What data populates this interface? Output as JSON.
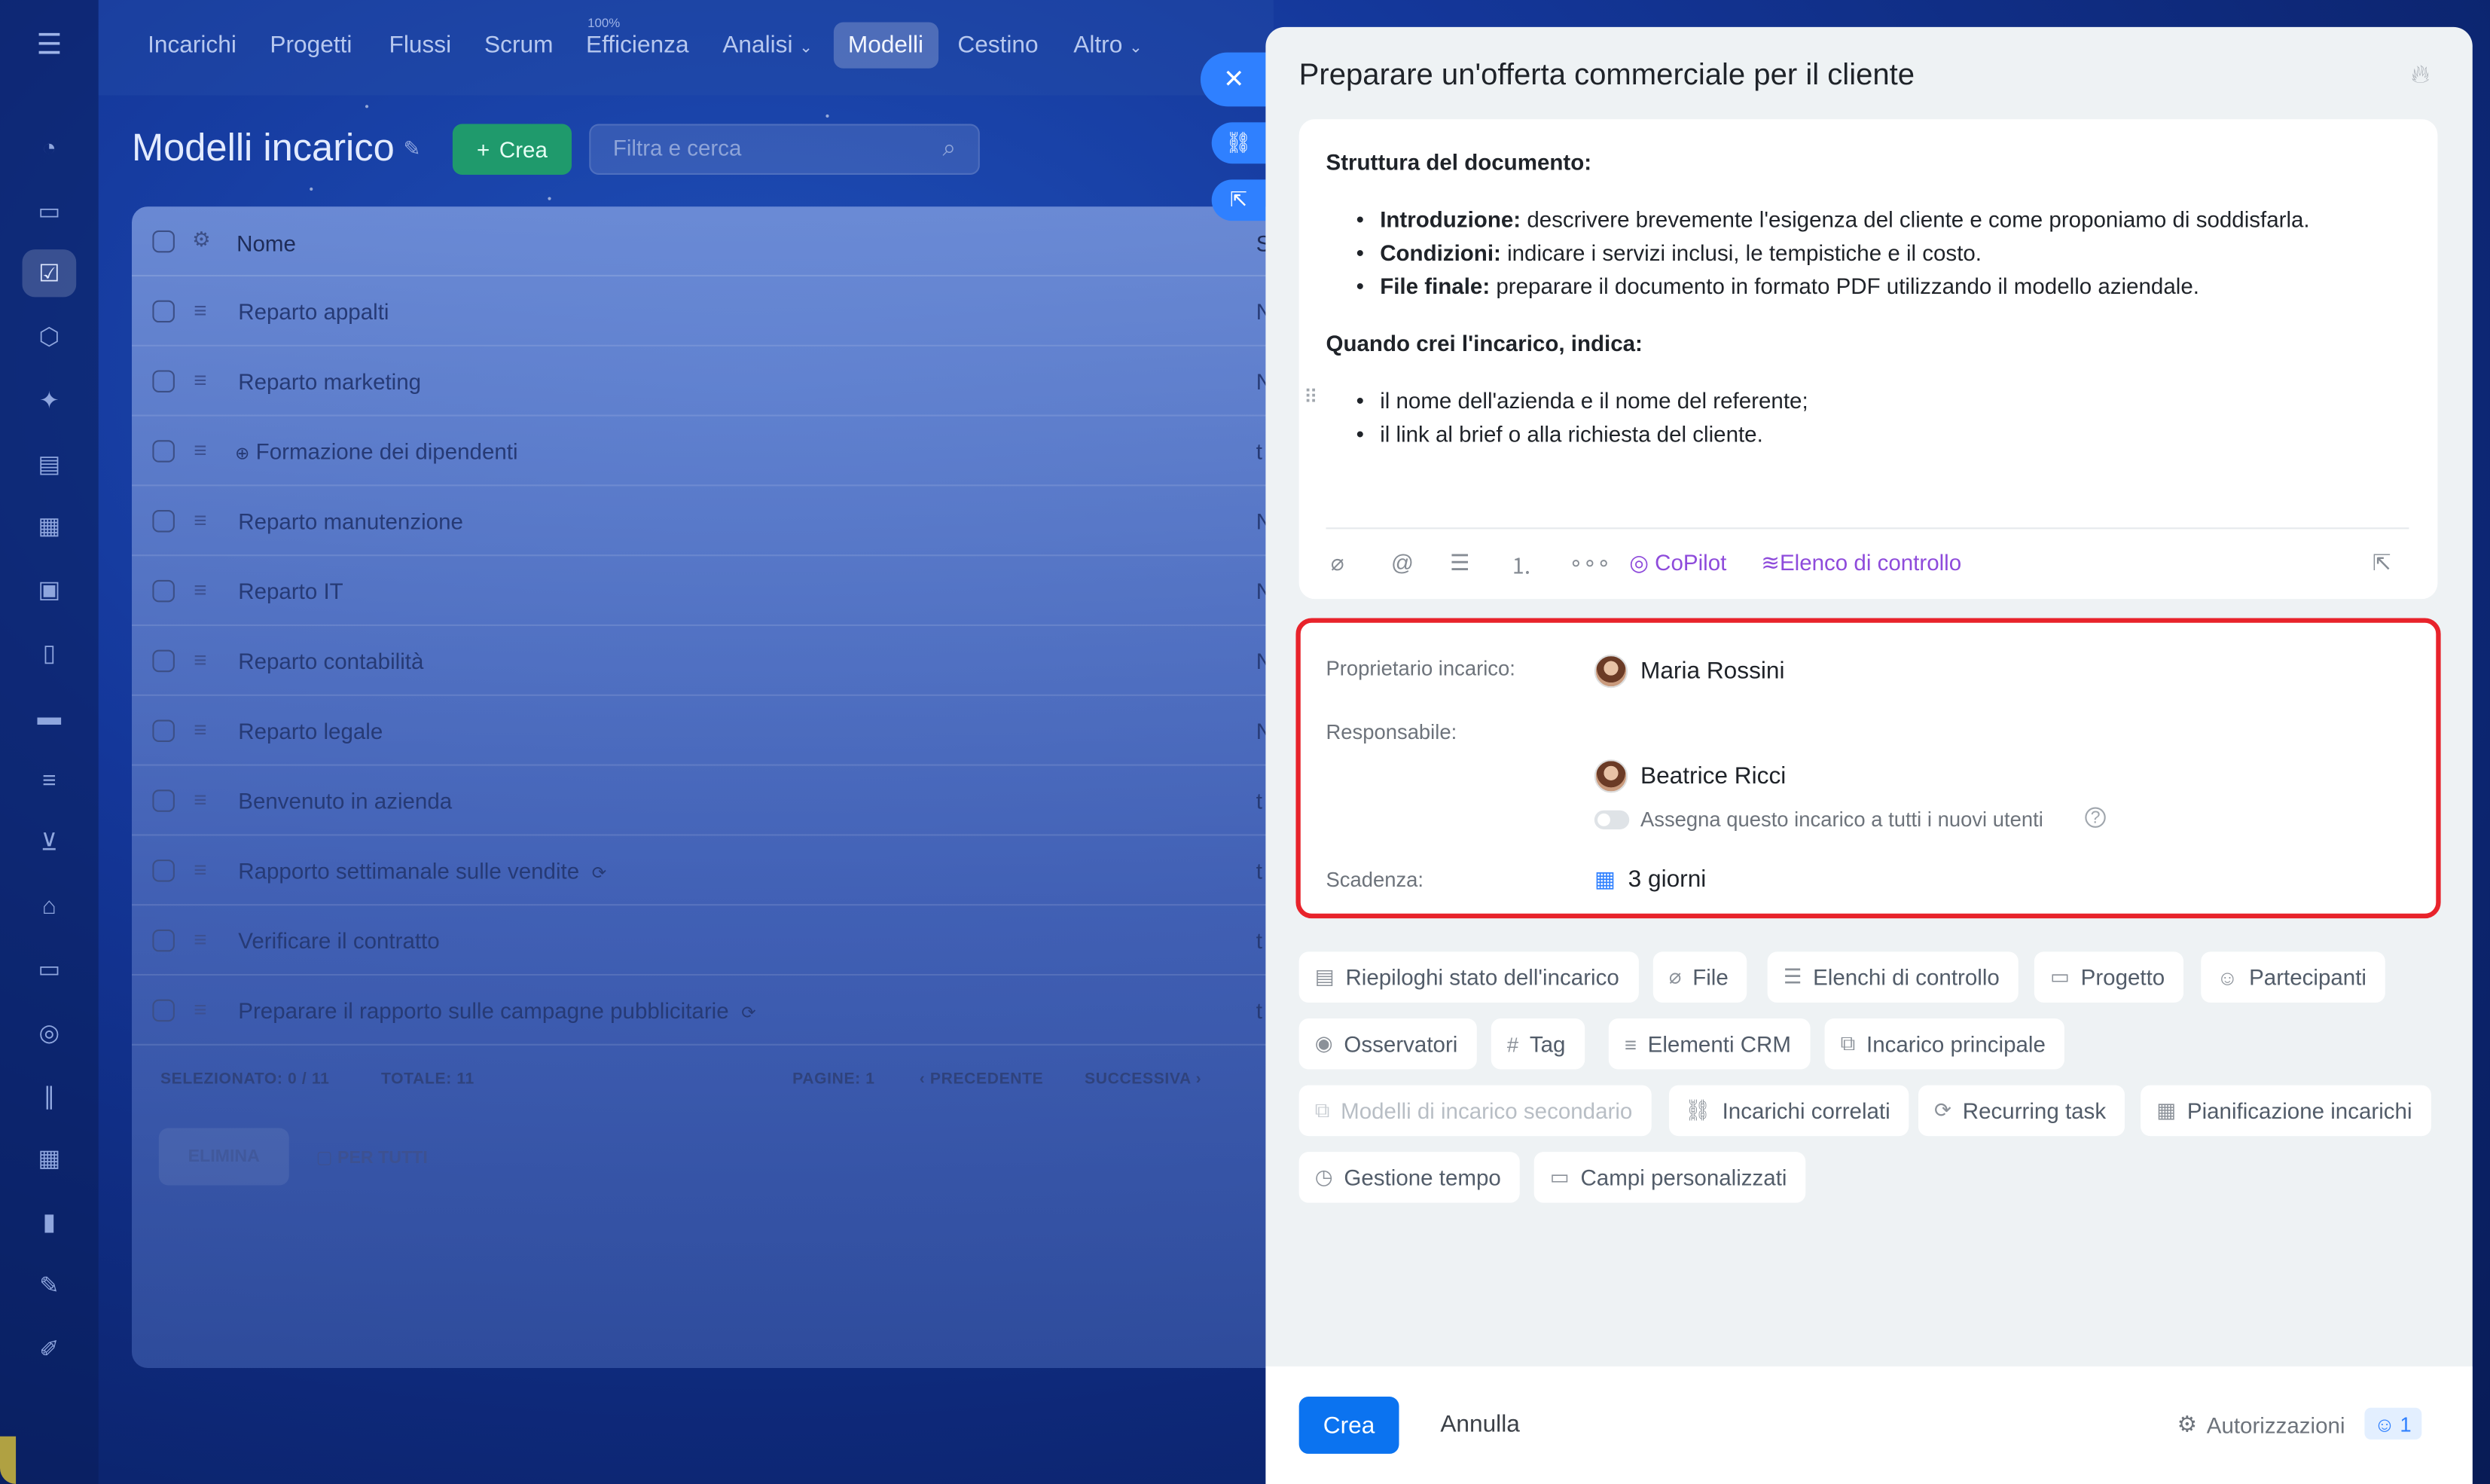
{
  "nav": {
    "items": [
      "Incarichi",
      "Progetti",
      "Flussi",
      "Scrum",
      "Efficienza",
      "Analisi",
      "Modelli",
      "Cestino",
      "Altro"
    ],
    "efficiency_badge": "100%",
    "active": "Modelli"
  },
  "page": {
    "title": "Modelli incarico",
    "create_label": "Crea",
    "search_placeholder": "Filtra e cerca"
  },
  "list": {
    "column_name": "Nome",
    "column_s": "S",
    "rows": [
      {
        "name": "Reparto appalti",
        "tail": "N"
      },
      {
        "name": "Reparto marketing",
        "tail": "N"
      },
      {
        "name": "Formazione dei dipendenti",
        "tail": "t"
      },
      {
        "name": "Reparto manutenzione",
        "tail": "N"
      },
      {
        "name": "Reparto IT",
        "tail": "N"
      },
      {
        "name": "Reparto contabilità",
        "tail": "N"
      },
      {
        "name": "Reparto legale",
        "tail": "N"
      },
      {
        "name": "Benvenuto in azienda",
        "tail": "t"
      },
      {
        "name": "Rapporto settimanale sulle vendite",
        "tail": "t"
      },
      {
        "name": "Verificare il contratto",
        "tail": "t"
      },
      {
        "name": "Preparare il rapporto sulle campagne pubblicitarie",
        "tail": "t"
      }
    ],
    "footer": {
      "selected": "SELEZIONATO: 0 / 11",
      "total": "TOTALE: 11",
      "pages": "PAGINE: 1",
      "prev": "‹ PRECEDENTE",
      "next": "SUCCESSIVA ›"
    },
    "delete_label": "ELIMINA",
    "for_all_label": "PER TUTTI"
  },
  "task": {
    "title": "Preparare un'offerta commerciale per il cliente",
    "section1_heading": "Struttura del documento:",
    "section1_items": [
      {
        "bold": "Introduzione:",
        "text": " descrivere brevemente l'esigenza del cliente e come proponiamo di soddisfarla."
      },
      {
        "bold": "Condizioni:",
        "text": " indicare i servizi inclusi, le tempistiche e il costo."
      },
      {
        "bold": "File finale:",
        "text": " preparare il documento in formato PDF utilizzando il modello aziendale."
      }
    ],
    "section2_heading": "Quando crei l'incarico, indica:",
    "section2_items": [
      "il nome dell'azienda e il nome del referente;",
      "il link al brief o alla richiesta del cliente."
    ],
    "toolbar": {
      "copilot": "CoPilot",
      "checklist": "Elenco di controllo"
    }
  },
  "fields": {
    "owner_label": "Proprietario incarico:",
    "owner_name": "Maria Rossini",
    "responsible_label": "Responsabile:",
    "responsible_name": "Beatrice Ricci",
    "assign_all_label": "Assegna questo incarico a tutti i nuovi utenti",
    "deadline_label": "Scadenza:",
    "deadline_value": "3 giorni"
  },
  "chips": [
    {
      "label": "Riepiloghi stato dell'incarico",
      "icon": "summary-icon"
    },
    {
      "label": "File",
      "icon": "paperclip-icon"
    },
    {
      "label": "Elenchi di controllo",
      "icon": "checklist-icon"
    },
    {
      "label": "Progetto",
      "icon": "folder-icon"
    },
    {
      "label": "Partecipanti",
      "icon": "person-icon"
    },
    {
      "label": "Osservatori",
      "icon": "eye-icon"
    },
    {
      "label": "Tag",
      "icon": "hash-icon"
    },
    {
      "label": "Elementi CRM",
      "icon": "crm-icon"
    },
    {
      "label": "Incarico principale",
      "icon": "parent-task-icon"
    },
    {
      "label": "Modelli di incarico secondario",
      "icon": "subtask-icon",
      "disabled": true
    },
    {
      "label": "Incarichi correlati",
      "icon": "link-icon"
    },
    {
      "label": "Recurring task",
      "icon": "repeat-icon"
    },
    {
      "label": "Pianificazione incarichi",
      "icon": "calendar-icon"
    },
    {
      "label": "Gestione tempo",
      "icon": "timer-icon"
    },
    {
      "label": "Campi personalizzati",
      "icon": "custom-fields-icon"
    }
  ],
  "footer": {
    "create_label": "Crea",
    "cancel_label": "Annulla",
    "permissions_label": "Autorizzazioni",
    "permissions_count": "1"
  },
  "colors": {
    "accent": "#0b73f0",
    "highlight_border": "#e8232b",
    "ai": "#8e4bdb",
    "create_green": "#1f9a6c"
  }
}
